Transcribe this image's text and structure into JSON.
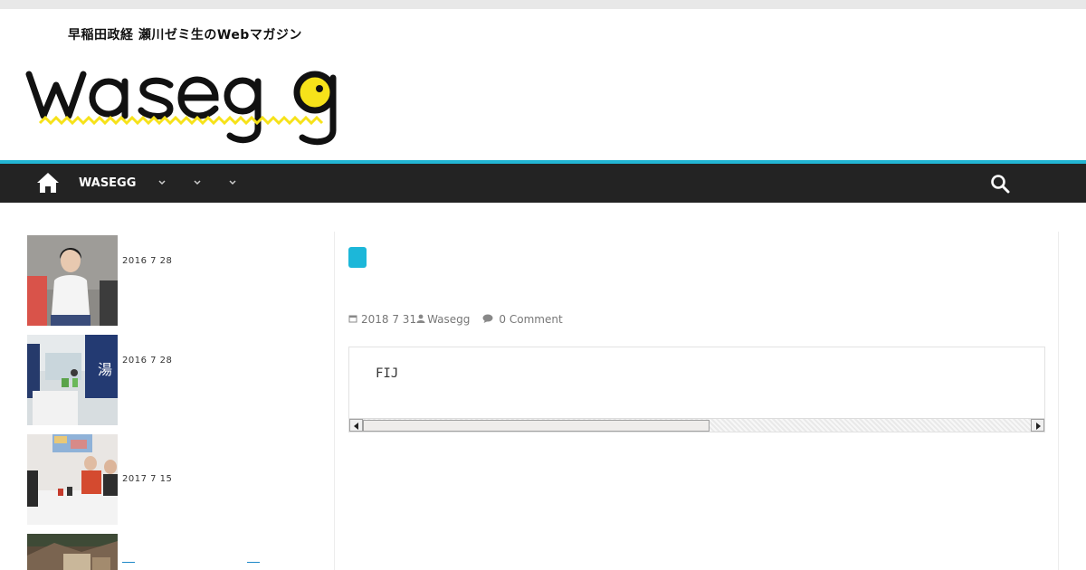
{
  "header": {
    "tagline": "早稲田政経 瀬川ゼミ生のWebマガジン",
    "logo_text": "wasegg"
  },
  "nav": {
    "items": [
      "WASEGG"
    ],
    "dropdown_count": 3
  },
  "sidebar": {
    "posts": [
      {
        "date": "2016  7  28"
      },
      {
        "date": "2016  7  28"
      },
      {
        "date": "2017  7  15"
      },
      {
        "date": ""
      }
    ]
  },
  "article": {
    "meta": {
      "date": "2018  7  31",
      "author": "Wasegg",
      "comments": "0 Comment"
    },
    "code": "FIJ"
  },
  "colors": {
    "accent": "#22b5d3",
    "nav_bg": "#232323",
    "badge": "#1cb7d9",
    "logo_yellow": "#f6e21a"
  }
}
